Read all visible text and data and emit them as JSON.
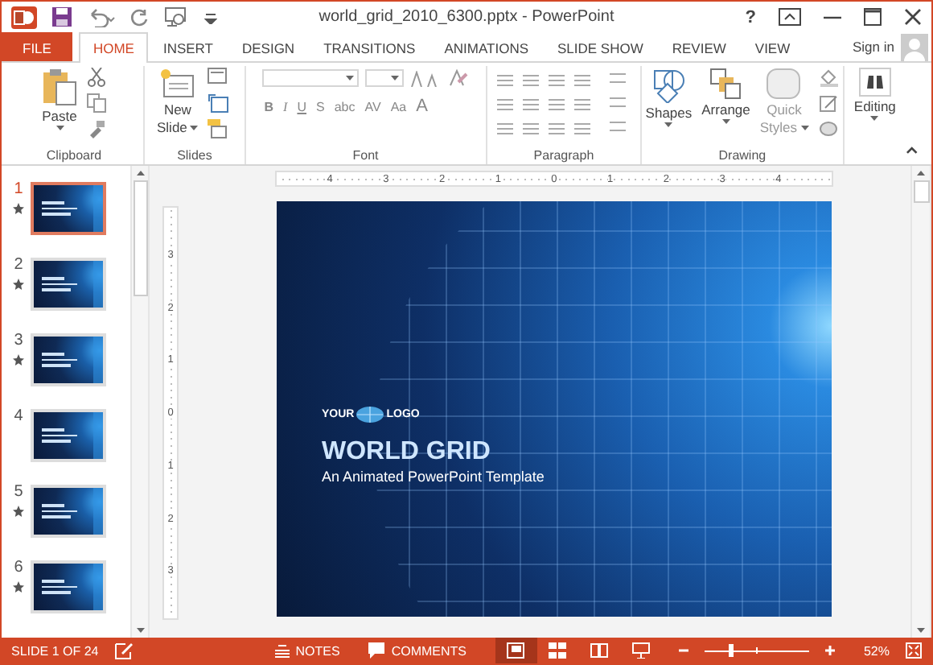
{
  "window": {
    "title": "world_grid_2010_6300.pptx - PowerPoint",
    "help": "?"
  },
  "tabs": [
    {
      "label": "FILE",
      "kind": "file",
      "selected": false
    },
    {
      "label": "HOME",
      "kind": "tab",
      "selected": true
    },
    {
      "label": "INSERT",
      "kind": "tab",
      "selected": false
    },
    {
      "label": "DESIGN",
      "kind": "tab",
      "selected": false
    },
    {
      "label": "TRANSITIONS",
      "kind": "tab",
      "selected": false
    },
    {
      "label": "ANIMATIONS",
      "kind": "tab",
      "selected": false
    },
    {
      "label": "SLIDE SHOW",
      "kind": "tab",
      "selected": false
    },
    {
      "label": "REVIEW",
      "kind": "tab",
      "selected": false
    },
    {
      "label": "VIEW",
      "kind": "tab",
      "selected": false
    }
  ],
  "sign_in": "Sign in",
  "ribbon": {
    "clipboard": {
      "label": "Clipboard",
      "paste": "Paste"
    },
    "slides": {
      "label": "Slides",
      "new_slide": [
        "New",
        "Slide"
      ]
    },
    "font": {
      "label": "Font",
      "buttons": [
        "B",
        "I",
        "U",
        "S",
        "abc",
        "AV",
        "Aa",
        "A"
      ]
    },
    "paragraph": {
      "label": "Paragraph"
    },
    "drawing": {
      "label": "Drawing",
      "shapes": "Shapes",
      "arrange": "Arrange",
      "quick_styles": [
        "Quick",
        "Styles"
      ]
    },
    "editing": {
      "label": "Editing"
    }
  },
  "slides": [
    {
      "number": "1",
      "selected": true,
      "animated": true
    },
    {
      "number": "2",
      "selected": false,
      "animated": true
    },
    {
      "number": "3",
      "selected": false,
      "animated": true
    },
    {
      "number": "4",
      "selected": false,
      "animated": false
    },
    {
      "number": "5",
      "selected": false,
      "animated": true
    },
    {
      "number": "6",
      "selected": false,
      "animated": true
    }
  ],
  "ruler_h": [
    "4",
    "3",
    "2",
    "1",
    "0",
    "1",
    "2",
    "3",
    "4"
  ],
  "ruler_v": [
    "3",
    "2",
    "1",
    "0",
    "1",
    "2",
    "3"
  ],
  "slide": {
    "logo_left": "YOUR",
    "logo_right": "LOGO",
    "title": "WORLD GRID",
    "subtitle": "An Animated PowerPoint Template"
  },
  "status_bar": {
    "slide_info": "SLIDE 1 OF 24",
    "notes": "NOTES",
    "comments": "COMMENTS",
    "views": [
      {
        "kind": "normal",
        "selected": true
      },
      {
        "kind": "sorter",
        "selected": false
      },
      {
        "kind": "reading",
        "selected": false
      },
      {
        "kind": "show",
        "selected": false
      }
    ],
    "zoom": {
      "level": 0.25,
      "reading": "52%"
    }
  }
}
